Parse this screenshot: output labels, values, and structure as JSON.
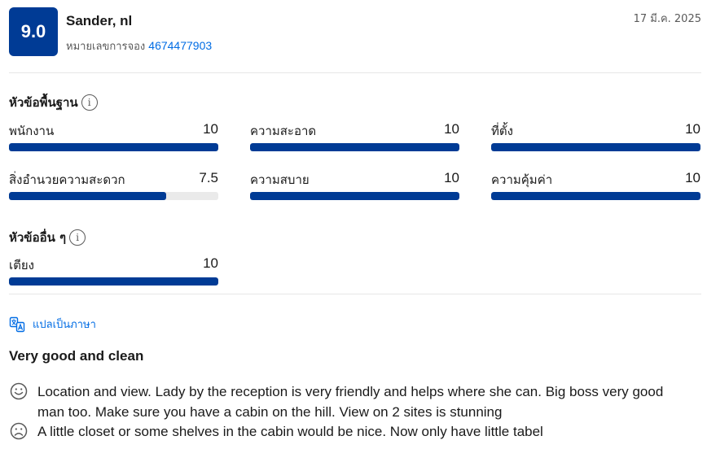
{
  "review": {
    "score": "9.0",
    "reviewer": "Sander, nl",
    "booking_label": "หมายเลขการจอง",
    "booking_number": "4674477903",
    "date": "17 มี.ค. 2025"
  },
  "basic_topics": {
    "title": "หัวข้อพื้นฐาน",
    "info_icon": "info-icon",
    "items": [
      {
        "label": "พนักงาน",
        "value": "10",
        "score": 10
      },
      {
        "label": "ความสะอาด",
        "value": "10",
        "score": 10
      },
      {
        "label": "ที่ตั้ง",
        "value": "10",
        "score": 10
      },
      {
        "label": "สิ่งอำนวยความสะดวก",
        "value": "7.5",
        "score": 7.5
      },
      {
        "label": "ความสบาย",
        "value": "10",
        "score": 10
      },
      {
        "label": "ความคุ้มค่า",
        "value": "10",
        "score": 10
      }
    ]
  },
  "other_topics": {
    "title": "หัวข้ออื่น ๆ",
    "items": [
      {
        "label": "เตียง",
        "value": "10",
        "score": 10
      }
    ]
  },
  "translate": {
    "label": "แปลเป็นภาษา",
    "icon": "translate-icon"
  },
  "review_body": {
    "title": "Very good and clean",
    "positive": "Location and view. Lady by the reception is very friendly and helps where she can. Big boss very good man too. Make sure you have a cabin on the hill. View on 2 sites is stunning",
    "negative": "A little closet or some shelves in the cabin would be nice. Now only have little tabel"
  },
  "colors": {
    "brand": "#003b95",
    "link": "#006ce4",
    "track": "#eaeaea"
  }
}
